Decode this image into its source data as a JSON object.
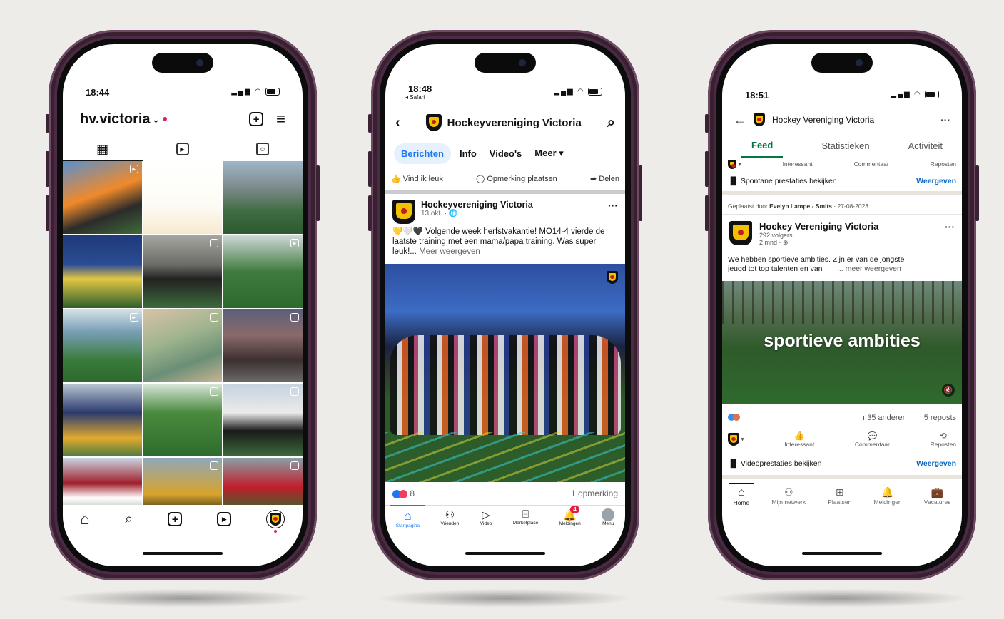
{
  "instagram": {
    "status_time": "18:44",
    "username": "hv.victoria",
    "chevron": "⌄",
    "tab_icons": [
      "grid-icon",
      "reels-icon",
      "tagged-icon"
    ],
    "tiles": [
      {
        "badge": "reel"
      },
      {
        "badge": ""
      },
      {
        "badge": ""
      },
      {
        "badge": ""
      },
      {
        "badge": "multi"
      },
      {
        "badge": "reel"
      },
      {
        "badge": "reel"
      },
      {
        "badge": "multi"
      },
      {
        "badge": "multi"
      },
      {
        "badge": ""
      },
      {
        "badge": "multi"
      },
      {
        "badge": "multi"
      },
      {
        "badge": ""
      },
      {
        "badge": "multi"
      },
      {
        "badge": "multi"
      }
    ],
    "nav_icons": [
      "home-icon",
      "search-icon",
      "create-icon",
      "reels-icon",
      "profile-avatar"
    ]
  },
  "facebook": {
    "status_time": "18:48",
    "back_app": "◂ Safari",
    "page_name": "Hockeyvereniging Victoria",
    "tabs": [
      "Berichten",
      "Info",
      "Video's",
      "Meer ▾"
    ],
    "actions": [
      "Vind ik leuk",
      "Opmerking plaatsen",
      "Delen"
    ],
    "post": {
      "author": "Hockeyvereniging Victoria",
      "meta": "13 okt. · ",
      "emojis": "💛🤍🖤",
      "text": " Volgende week herfstvakantie! MO14-4 vierde de laatste training met een mama/papa training. Was super leuk!...",
      "more": "Meer weergeven",
      "reaction_count": "8",
      "comments": "1 opmerking"
    },
    "nav": [
      {
        "label": "Startpagina",
        "icon": "home-icon"
      },
      {
        "label": "Vrienden",
        "icon": "friends-icon"
      },
      {
        "label": "Video",
        "icon": "video-icon"
      },
      {
        "label": "Marketplace",
        "icon": "marketplace-icon"
      },
      {
        "label": "Meldingen",
        "icon": "bell-icon",
        "badge": "4"
      },
      {
        "label": "Menu",
        "icon": "menu-avatar"
      }
    ],
    "accent": "#1877f2"
  },
  "linkedin": {
    "status_time": "18:51",
    "page_name": "Hockey Vereniging Victoria",
    "tabs": [
      "Feed",
      "Statistieken",
      "Activiteit"
    ],
    "prev_actions": [
      "Interessant",
      "Commentaar",
      "Reposten"
    ],
    "prev_stats": "Spontane prestaties bekijken",
    "view_label": "Weergeven",
    "posted_by_prefix": "Geplaatst door ",
    "posted_by_name": "Evelyn Lampe - Smits",
    "posted_by_date": " · 27-08-2023",
    "post": {
      "author": "Hockey Vereniging Victoria",
      "followers": "292 volgers",
      "age": "2 mnd · ",
      "text_1": "We hebben sportieve ambities. Zijn er van de jongste",
      "text_2": "jeugd tot top talenten en van",
      "more": "... meer weergeven",
      "video_caption": "sportieve ambities",
      "others": "35 anderen",
      "reposts": "5 reposts"
    },
    "actions": [
      "Interessant",
      "Commentaar",
      "Reposten"
    ],
    "video_stats": "Videoprestaties bekijken",
    "nav": [
      {
        "label": "Home",
        "icon": "home-icon"
      },
      {
        "label": "Mijn netwerk",
        "icon": "network-icon"
      },
      {
        "label": "Plaatsen",
        "icon": "post-icon"
      },
      {
        "label": "Meldingen",
        "icon": "bell-icon"
      },
      {
        "label": "Vacatures",
        "icon": "briefcase-icon"
      }
    ],
    "accent": "#0a66c2"
  }
}
